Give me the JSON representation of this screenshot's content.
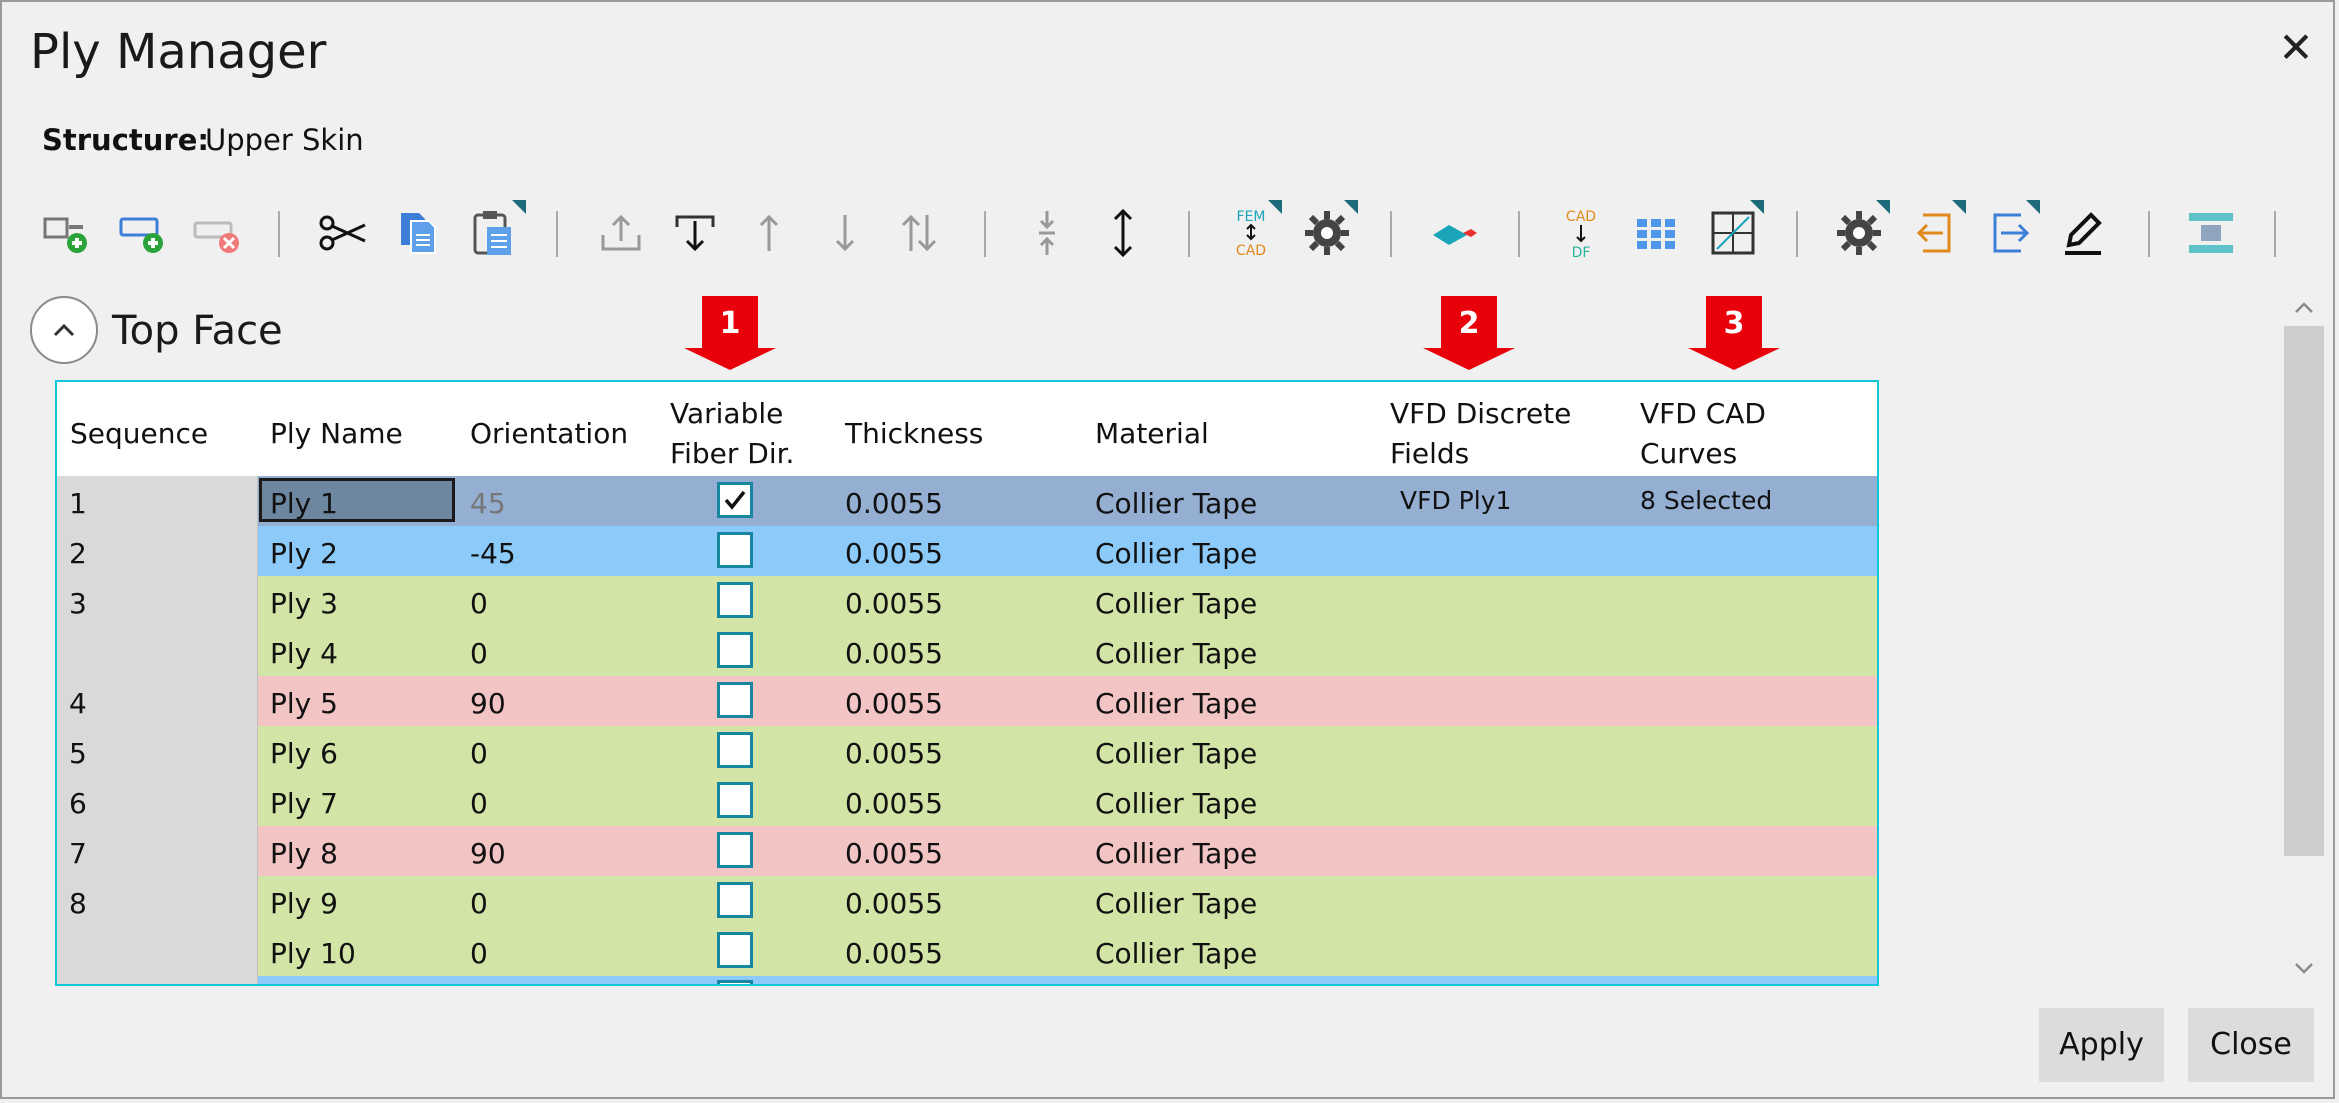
{
  "dialog": {
    "title": "Ply Manager",
    "close_glyph": "✕",
    "structure_label": "Structure:",
    "structure_value": "Upper Skin"
  },
  "toolbar": {
    "icons": [
      "add-ply-icon",
      "add-ply-alt-icon",
      "remove-ply-icon",
      "cut-icon",
      "copy-icon",
      "paste-icon",
      "move-to-top-icon",
      "insert-below-icon",
      "move-up-icon",
      "move-down-icon",
      "swap-icon",
      "collapse-icon",
      "expand-icon",
      "fem-to-cad-icon",
      "settings-icon",
      "vfd-icon",
      "cad-to-df-icon",
      "grid-icon",
      "table-icon",
      "settings-2-icon",
      "import-icon",
      "export-icon",
      "edit-icon",
      "layers-icon"
    ],
    "fem_to_cad": {
      "top": "FEM",
      "bottom": "CAD"
    },
    "cad_to_df": {
      "top": "CAD",
      "bottom": "DF"
    }
  },
  "section": {
    "title": "Top Face",
    "toggle_glyph": "^"
  },
  "markers": [
    "1",
    "2",
    "3"
  ],
  "table": {
    "headers": {
      "sequence": "Sequence",
      "ply_name": "Ply Name",
      "orientation": "Orientation",
      "variable_fiber_1": "Variable",
      "variable_fiber_2": "Fiber Dir.",
      "thickness": "Thickness",
      "material": "Material",
      "vfd_fields_1": "VFD Discrete",
      "vfd_fields_2": "Fields",
      "vfd_curves_1": "VFD CAD",
      "vfd_curves_2": "Curves"
    },
    "rows": [
      {
        "seq": "1",
        "name": "Ply 1",
        "orientation": "45",
        "checked": true,
        "thickness": "0.0055",
        "material": "Collier Tape",
        "vfd_fields": "VFD Ply1",
        "vfd_curves": "8 Selected",
        "color": "#94afd2"
      },
      {
        "seq": "2",
        "name": "Ply 2",
        "orientation": "-45",
        "checked": false,
        "thickness": "0.0055",
        "material": "Collier Tape",
        "vfd_fields": "",
        "vfd_curves": "",
        "color": "#8ccafa"
      },
      {
        "seq": "3",
        "name": "Ply 3",
        "orientation": "0",
        "checked": false,
        "thickness": "0.0055",
        "material": "Collier Tape",
        "vfd_fields": "",
        "vfd_curves": "",
        "color": "#d2e4a6"
      },
      {
        "seq": "",
        "name": "Ply 4",
        "orientation": "0",
        "checked": false,
        "thickness": "0.0055",
        "material": "Collier Tape",
        "vfd_fields": "",
        "vfd_curves": "",
        "color": "#d2e4a6"
      },
      {
        "seq": "4",
        "name": "Ply 5",
        "orientation": "90",
        "checked": false,
        "thickness": "0.0055",
        "material": "Collier Tape",
        "vfd_fields": "",
        "vfd_curves": "",
        "color": "#f2c4c4"
      },
      {
        "seq": "5",
        "name": "Ply 6",
        "orientation": "0",
        "checked": false,
        "thickness": "0.0055",
        "material": "Collier Tape",
        "vfd_fields": "",
        "vfd_curves": "",
        "color": "#d2e4a6"
      },
      {
        "seq": "6",
        "name": "Ply 7",
        "orientation": "0",
        "checked": false,
        "thickness": "0.0055",
        "material": "Collier Tape",
        "vfd_fields": "",
        "vfd_curves": "",
        "color": "#d2e4a6"
      },
      {
        "seq": "7",
        "name": "Ply 8",
        "orientation": "90",
        "checked": false,
        "thickness": "0.0055",
        "material": "Collier Tape",
        "vfd_fields": "",
        "vfd_curves": "",
        "color": "#f2c4c4"
      },
      {
        "seq": "8",
        "name": "Ply 9",
        "orientation": "0",
        "checked": false,
        "thickness": "0.0055",
        "material": "Collier Tape",
        "vfd_fields": "",
        "vfd_curves": "",
        "color": "#d2e4a6"
      },
      {
        "seq": "",
        "name": "Ply 10",
        "orientation": "0",
        "checked": false,
        "thickness": "0.0055",
        "material": "Collier Tape",
        "vfd_fields": "",
        "vfd_curves": "",
        "color": "#d2e4a6"
      },
      {
        "seq": "",
        "name": "",
        "orientation": "",
        "checked": false,
        "thickness": "",
        "material": "",
        "vfd_fields": "",
        "vfd_curves": "",
        "color": "#8ccafa"
      }
    ]
  },
  "footer": {
    "apply_label": "Apply",
    "close_label": "Close"
  }
}
